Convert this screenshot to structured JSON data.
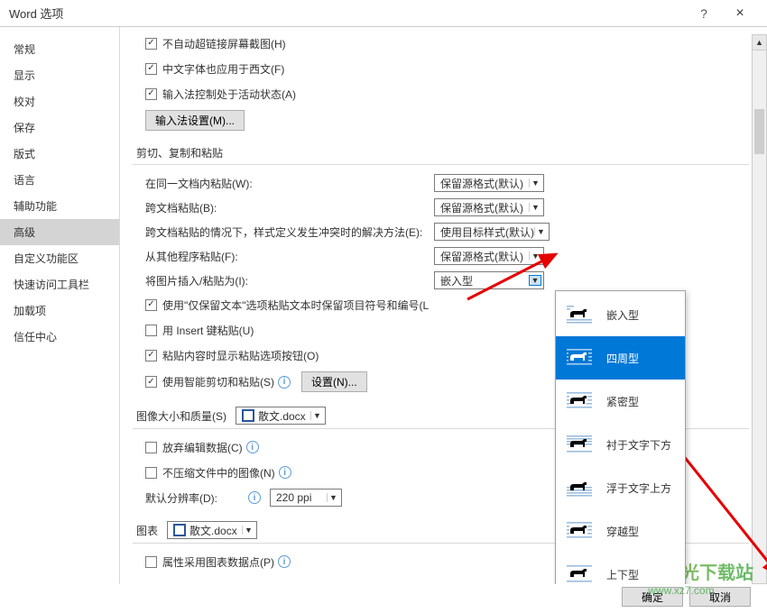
{
  "window": {
    "title": "Word 选项",
    "help": "?",
    "close": "×"
  },
  "sidebar": {
    "items": [
      "常规",
      "显示",
      "校对",
      "保存",
      "版式",
      "语言",
      "辅助功能",
      "高级",
      "自定义功能区",
      "快速访问工具栏",
      "加载项",
      "信任中心"
    ],
    "selectedIndex": 7
  },
  "top_checks": [
    {
      "label": "不自动超链接屏幕截图(H)",
      "checked": true
    },
    {
      "label": "中文字体也应用于西文(F)",
      "checked": true
    },
    {
      "label": "输入法控制处于活动状态(A)",
      "checked": true
    }
  ],
  "ime_btn": "输入法设置(M)...",
  "sections": {
    "cut": "剪切、复制和粘贴",
    "img": "图像大小和质量(S)",
    "chart": "图表"
  },
  "paste": {
    "rows": [
      {
        "label": "在同一文档内粘贴(W):",
        "value": "保留源格式(默认)"
      },
      {
        "label": "跨文档粘贴(B):",
        "value": "保留源格式(默认)"
      },
      {
        "label": "跨文档粘贴的情况下，样式定义发生冲突时的解决方法(E):",
        "value": "使用目标样式(默认)"
      },
      {
        "label": "从其他程序粘贴(F):",
        "value": "保留源格式(默认)"
      },
      {
        "label": "将图片插入/粘贴为(I):",
        "value": "嵌入型"
      }
    ]
  },
  "paste_checks": [
    {
      "label": "使用\"仅保留文本\"选项粘贴文本时保留项目符号和编号(L",
      "checked": true
    },
    {
      "label": "用 Insert 键粘贴(U)",
      "checked": false
    },
    {
      "label": "粘贴内容时显示粘贴选项按钮(O)",
      "checked": true
    },
    {
      "label": "使用智能剪切和粘贴(S)",
      "checked": true,
      "has_info": true
    }
  ],
  "settings_btn": "设置(N)...",
  "img_section": {
    "doc": "散文.docx",
    "checks": [
      {
        "label": "放弃编辑数据(C)",
        "checked": false,
        "has_info": true
      },
      {
        "label": "不压缩文件中的图像(N)",
        "checked": false,
        "has_info": true
      }
    ],
    "res_label": "默认分辨率(D):",
    "res_value": "220 ppi"
  },
  "chart_section": {
    "doc": "散文.docx",
    "check": {
      "label": "属性采用图表数据点(P)",
      "checked": false,
      "has_info": true
    }
  },
  "wrap_options": [
    "嵌入型",
    "四周型",
    "紧密型",
    "衬于文字下方",
    "浮于文字上方",
    "穿越型",
    "上下型"
  ],
  "wrap_selected_index": 1,
  "buttons": {
    "ok": "确定",
    "cancel": "取消"
  },
  "watermark": {
    "main": "极光下载站",
    "sub": "www.xz7.com"
  }
}
